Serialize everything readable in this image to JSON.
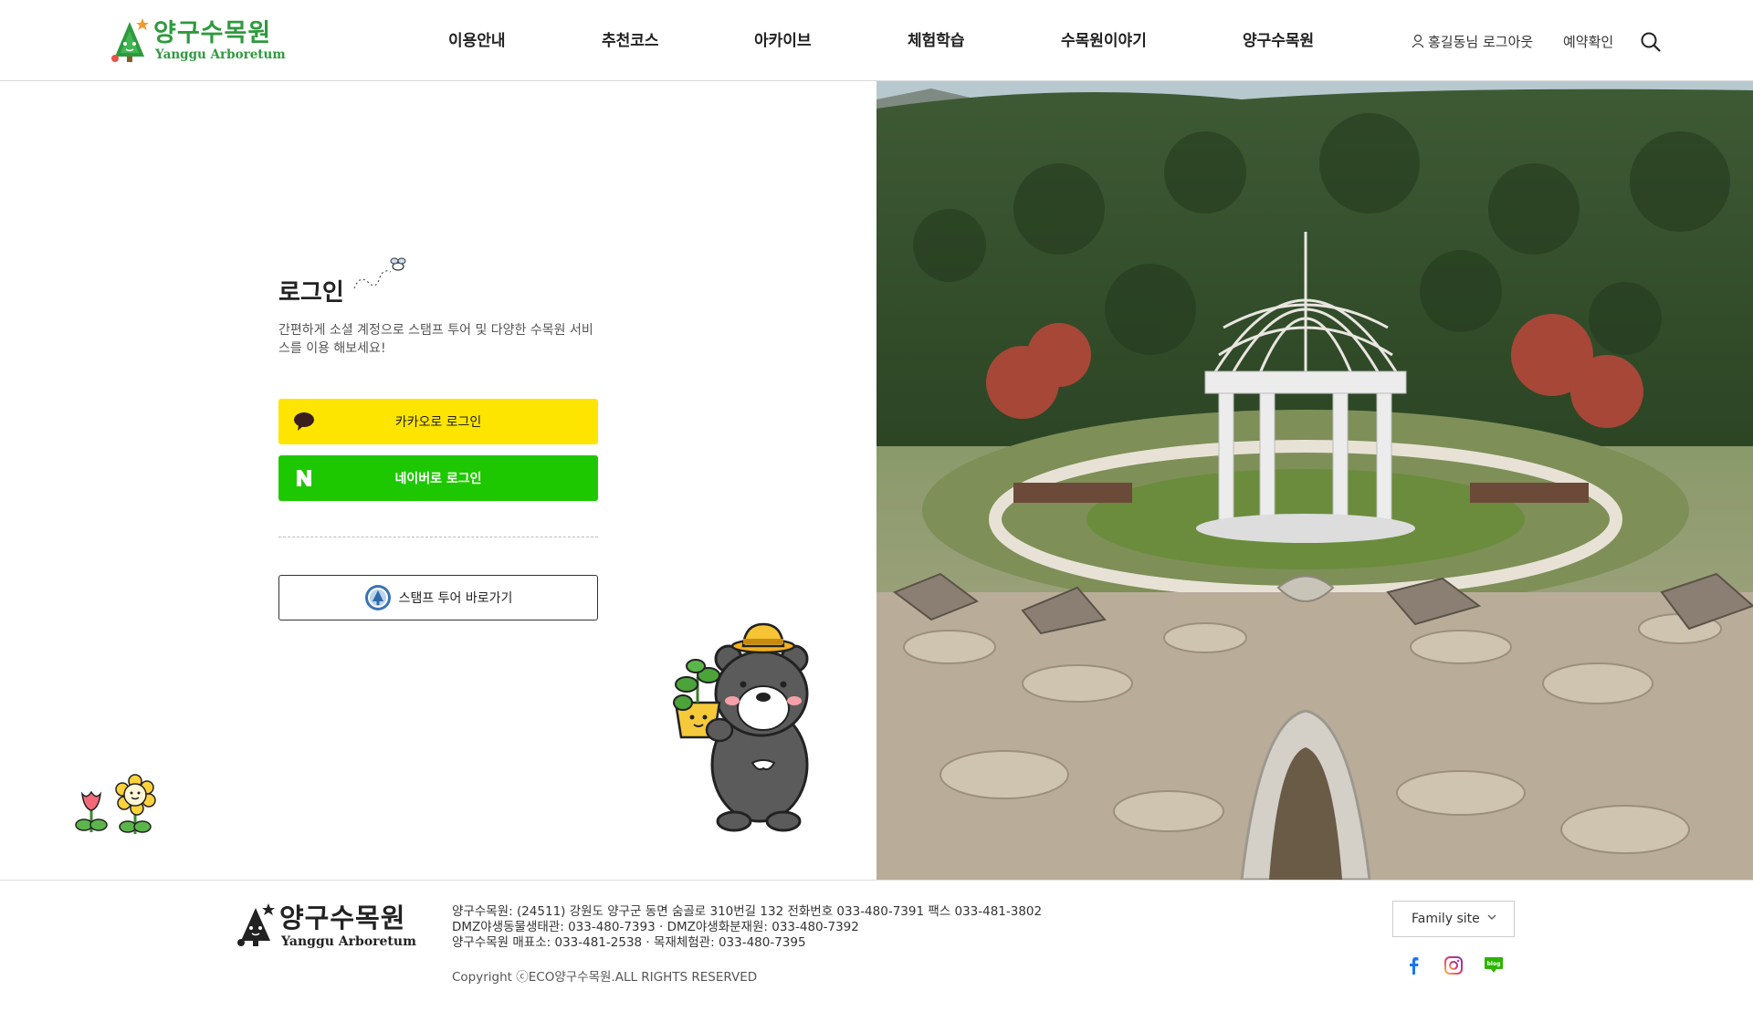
{
  "header": {
    "logo": {
      "ko": "양구수목원",
      "en": "Yanggu Arboretum"
    },
    "nav": [
      "이용안내",
      "추천코스",
      "아카이브",
      "체험학습",
      "수목원이야기",
      "양구수목원"
    ],
    "user_name": "홍길동",
    "user_suffix": "님",
    "logout": "로그아웃",
    "reservation": "예약확인",
    "search_icon": "search-icon"
  },
  "login": {
    "title": "로그인",
    "description": "간편하게 소셜 계정으로 스탬프 투어 및 다양한 수목원 서비스를 이용 해보세요!",
    "kakao": {
      "label": "카카오로 로그인",
      "color": "#fee500"
    },
    "naver": {
      "label": "네이버로 로그인",
      "color": "#1ec800"
    },
    "stamp": {
      "label": "스탬프 투어 바로가기"
    }
  },
  "footer": {
    "logo": {
      "ko": "양구수목원",
      "en": "Yanggu Arboretum"
    },
    "info": [
      "양구수목원: (24511) 강원도 양구군 동면 숨골로 310번길 132 전화번호 033-480-7391 팩스 033-481-3802",
      "DMZ야생동물생태관: 033-480-7393 · DMZ야생화분재원: 033-480-7392",
      "양구수목원 매표소: 033-481-2538 · 목재체험관: 033-480-7395"
    ],
    "copyright": "Copyright ⓒECO양구수목원.ALL RIGHTS RESERVED",
    "family_site": "Family site",
    "sns": [
      "facebook-icon",
      "instagram-icon",
      "blog-icon"
    ]
  }
}
